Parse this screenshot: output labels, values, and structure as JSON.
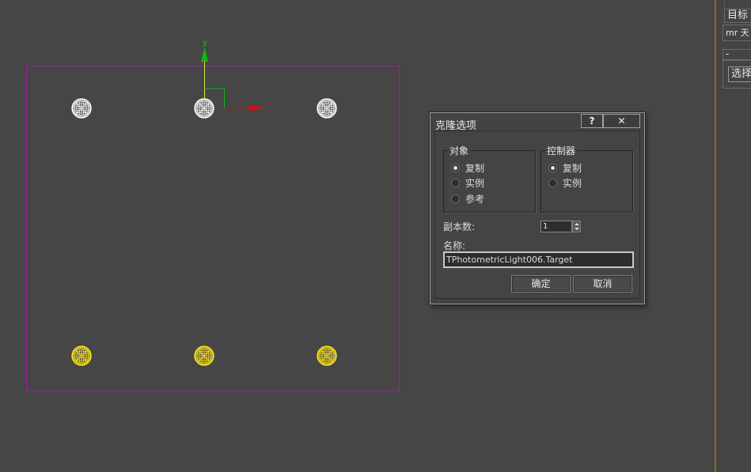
{
  "viewport": {
    "gizmo_y_label": "y",
    "gizmo_x_label": "x",
    "selection_box_color": "#a01ca0",
    "gizmo_y_color": "#14b414",
    "gizmo_x_color": "#c81414",
    "light_white_color": "#ffffff",
    "light_yellow_color": "#ffe81e"
  },
  "right_panel": {
    "item_top": "目标",
    "item_mr": "mr 天",
    "rollout_minus": "-",
    "select_button": "选择"
  },
  "dialog": {
    "title": "克隆选项",
    "help_label": "?",
    "close_label": "✕",
    "object_group": {
      "title": "对象",
      "options": [
        {
          "label": "复制",
          "checked": true
        },
        {
          "label": "实例",
          "checked": false
        },
        {
          "label": "参考",
          "checked": false
        }
      ]
    },
    "controller_group": {
      "title": "控制器",
      "options": [
        {
          "label": "复制",
          "checked": true
        },
        {
          "label": "实例",
          "checked": false
        }
      ]
    },
    "copies_label": "副本数:",
    "copies_value": "1",
    "name_label": "名称:",
    "name_value": "TPhotometricLight006.Target",
    "ok_label": "确定",
    "cancel_label": "取消"
  }
}
